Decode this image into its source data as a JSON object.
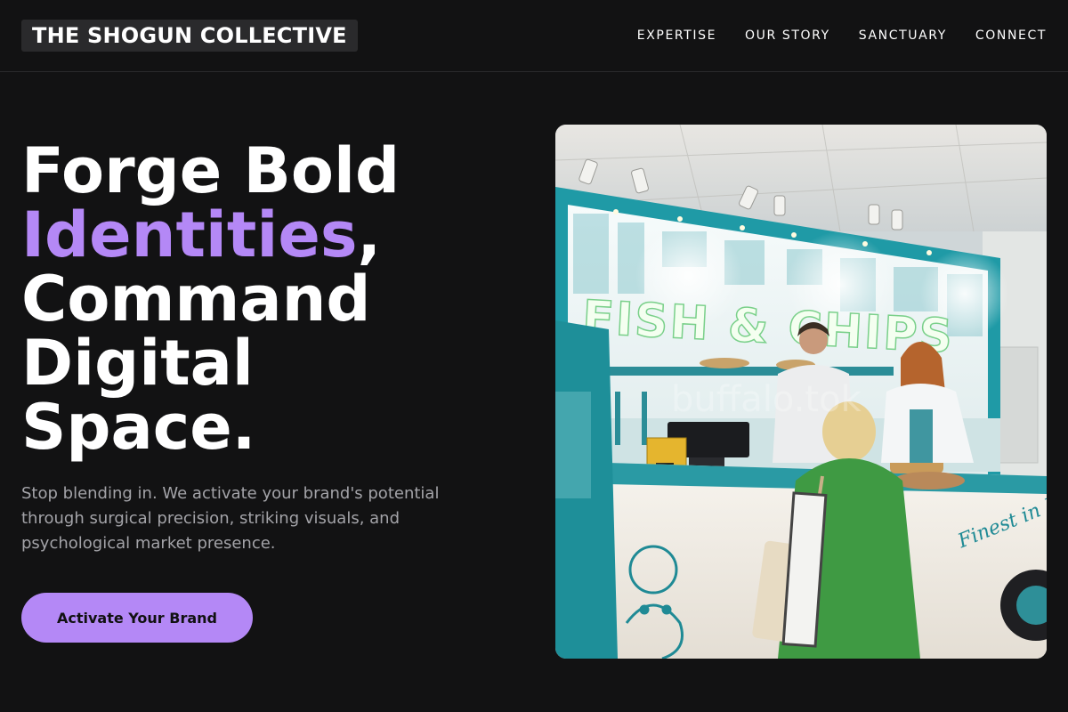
{
  "brand": {
    "name": "THE SHOGUN COLLECTIVE"
  },
  "nav": {
    "items": [
      {
        "label": "EXPERTISE"
      },
      {
        "label": "OUR STORY"
      },
      {
        "label": "SANCTUARY"
      },
      {
        "label": "CONNECT"
      }
    ]
  },
  "hero": {
    "headline_line1": "Forge Bold",
    "headline_accent": "Identities",
    "headline_comma": ",",
    "headline_line3": "Command",
    "headline_line4": "Digital",
    "headline_line5": "Space.",
    "subtext": "Stop blending in. We activate your brand's potential through surgical precision, striking visuals, and psychological market presence.",
    "cta_label": "Activate Your Brand"
  },
  "image": {
    "sign_text": "FISH & CHIPS",
    "script_text": "Finest in London",
    "watermark": "buffalo.tok"
  },
  "colors": {
    "background": "#121213",
    "accent": "#b488f6",
    "text": "#ffffff",
    "muted_text": "#a3a3a8"
  }
}
